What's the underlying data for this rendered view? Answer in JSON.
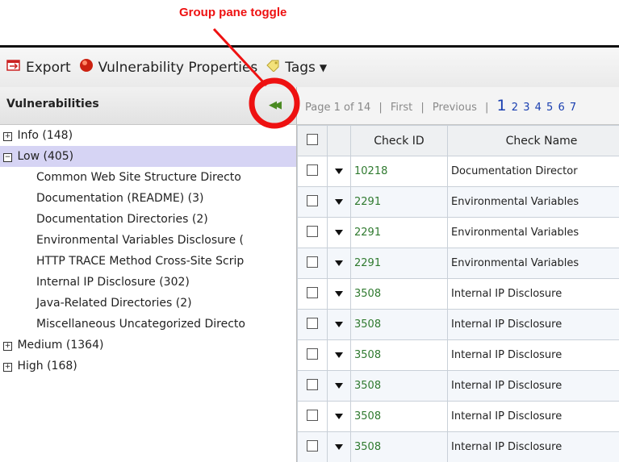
{
  "annotation": {
    "label": "Group pane toggle"
  },
  "toolbar": {
    "export_label": "Export",
    "vuln_props_label": "Vulnerability Properties",
    "tags_label": "Tags"
  },
  "left": {
    "title": "Vulnerabilities",
    "groups": [
      {
        "label": "Info",
        "count": "(148)",
        "expander": "+"
      },
      {
        "label": "Low",
        "count": "(405)",
        "expander": "−"
      },
      {
        "label": "Medium",
        "count": "(1364)",
        "expander": "+"
      },
      {
        "label": "High",
        "count": "(168)",
        "expander": "+"
      }
    ],
    "low_children": [
      "Common Web Site Structure Directo",
      "Documentation (README)  (3)",
      "Documentation Directories  (2)",
      "Environmental Variables Disclosure  (",
      "HTTP TRACE Method Cross-Site Scrip",
      "Internal IP Disclosure  (302)",
      "Java-Related Directories  (2)",
      "Miscellaneous Uncategorized Directo"
    ]
  },
  "pager": {
    "text": "Page 1 of 14",
    "sep": "|",
    "first": "First",
    "previous": "Previous",
    "current": "1",
    "pages": [
      "2",
      "3",
      "4",
      "5",
      "6",
      "7"
    ]
  },
  "table": {
    "headers": [
      "Check ID",
      "Check Name"
    ],
    "rows": [
      {
        "id": "10218",
        "name": "Documentation Director"
      },
      {
        "id": "2291",
        "name": "Environmental Variables"
      },
      {
        "id": "2291",
        "name": "Environmental Variables"
      },
      {
        "id": "2291",
        "name": "Environmental Variables"
      },
      {
        "id": "3508",
        "name": "Internal IP Disclosure"
      },
      {
        "id": "3508",
        "name": "Internal IP Disclosure"
      },
      {
        "id": "3508",
        "name": "Internal IP Disclosure"
      },
      {
        "id": "3508",
        "name": "Internal IP Disclosure"
      },
      {
        "id": "3508",
        "name": "Internal IP Disclosure"
      },
      {
        "id": "3508",
        "name": "Internal IP Disclosure"
      }
    ]
  },
  "colors": {
    "annotation": "#ee1111",
    "selected_row": "#d6d4f4",
    "check_id": "#2f7a2f"
  }
}
